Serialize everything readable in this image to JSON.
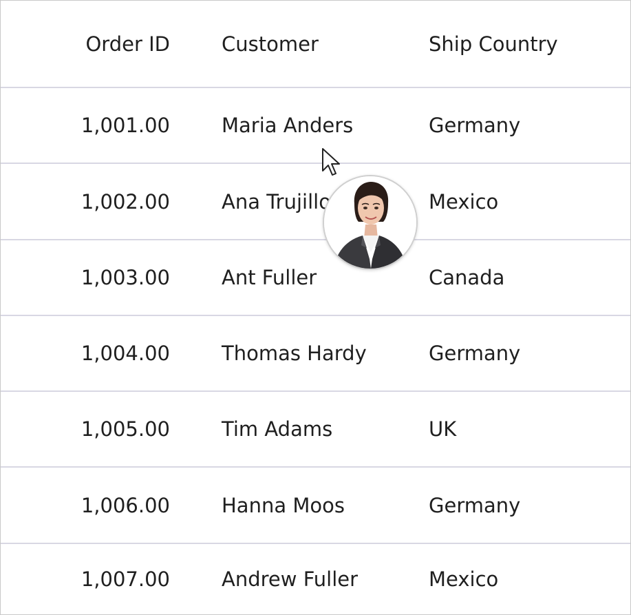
{
  "columns": {
    "order_id": "Order ID",
    "customer": "Customer",
    "ship_country": "Ship Country"
  },
  "rows": [
    {
      "order_id": "1,001.00",
      "customer": "Maria Anders",
      "ship_country": "Germany"
    },
    {
      "order_id": "1,002.00",
      "customer": "Ana Trujillo",
      "ship_country": "Mexico"
    },
    {
      "order_id": "1,003.00",
      "customer": "Ant Fuller",
      "ship_country": "Canada"
    },
    {
      "order_id": "1,004.00",
      "customer": "Thomas Hardy",
      "ship_country": "Germany"
    },
    {
      "order_id": "1,005.00",
      "customer": "Tim Adams",
      "ship_country": "UK"
    },
    {
      "order_id": "1,006.00",
      "customer": "Hanna Moos",
      "ship_country": "Germany"
    },
    {
      "order_id": "1,007.00",
      "customer": "Andrew Fuller",
      "ship_country": "Mexico"
    }
  ],
  "tooltip": {
    "icon": "avatar-photo"
  },
  "colors": {
    "row_divider": "#d8d7e3",
    "text": "#1f1f1f",
    "border": "#c9c9c9"
  }
}
